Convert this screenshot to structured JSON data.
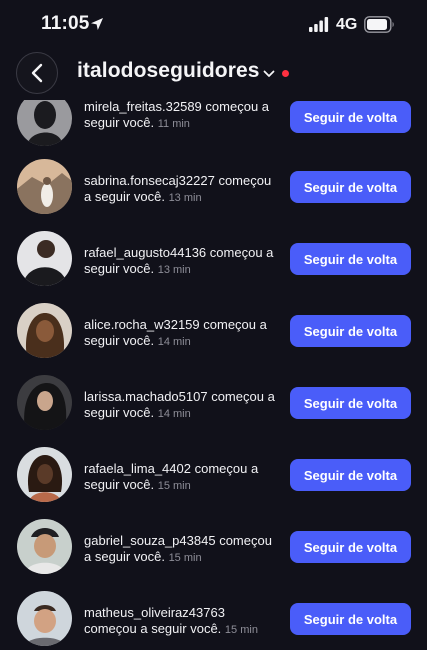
{
  "status_bar": {
    "time": "11:05",
    "network": "4G"
  },
  "header": {
    "title": "italodoseguidores",
    "notification_color": "#ff3040"
  },
  "colors": {
    "accent": "#4a5df9",
    "background": "#11111a"
  },
  "notifications": [
    {
      "username": "mirela_freitas.32589",
      "action": "começou a seguir você.",
      "time": "11 min",
      "button_label": "Seguir de volta",
      "avatar_colors": [
        "#9a9a9e",
        "#1b1b1f"
      ]
    },
    {
      "username": "sabrina.fonsecaj32227",
      "action": "começou a seguir você.",
      "time": "13 min",
      "button_label": "Seguir de volta",
      "avatar_colors": [
        "#d7b89a",
        "#6f5846"
      ]
    },
    {
      "username": "rafael_augusto44136",
      "action": "começou a seguir você.",
      "time": "13 min",
      "button_label": "Seguir de volta",
      "avatar_colors": [
        "#e4e4e7",
        "#1a1a1e"
      ]
    },
    {
      "username": "alice.rocha_w32159",
      "action": "começou a seguir você.",
      "time": "14 min",
      "button_label": "Seguir de volta",
      "avatar_colors": [
        "#d9d0c6",
        "#6b4a32"
      ]
    },
    {
      "username": "larissa.machado5107",
      "action": "começou a seguir você.",
      "time": "14 min",
      "button_label": "Seguir de volta",
      "avatar_colors": [
        "#3c3c40",
        "#1a1a1d"
      ]
    },
    {
      "username": "rafaela_lima_4402",
      "action": "começou a seguir você.",
      "time": "15 min",
      "button_label": "Seguir de volta",
      "avatar_colors": [
        "#d9dde0",
        "#4a3025"
      ]
    },
    {
      "username": "gabriel_souza_p43845",
      "action": "começou a seguir você.",
      "time": "15 min",
      "button_label": "Seguir de volta",
      "avatar_colors": [
        "#c8d0cc",
        "#7a5a48"
      ]
    },
    {
      "username": "matheus_oliveiraz43763",
      "action": "começou a seguir você.",
      "time": "15 min",
      "button_label": "Seguir de volta",
      "avatar_colors": [
        "#cfd6dc",
        "#8a6a58"
      ]
    }
  ]
}
